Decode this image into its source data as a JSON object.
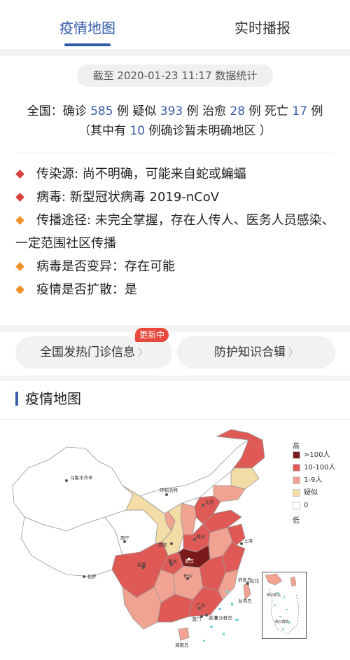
{
  "tabs": [
    {
      "label": "疫情地图",
      "active": true
    },
    {
      "label": "实时播报",
      "active": false
    }
  ],
  "date_line": "截至 2020-01-23 11:17 数据统计",
  "summary": {
    "prefix": "全国：确诊",
    "confirmed": "585",
    "unit1": "例 疑似",
    "suspected": "393",
    "unit2": "例 治愈",
    "cured": "28",
    "unit3": "例 死亡",
    "dead": "17",
    "unit4": "例",
    "line2_prefix": "（其中有",
    "unlocated": "10",
    "line2_suffix": "例确诊暂未明确地区 ）"
  },
  "facts": [
    {
      "text": "传染源: 尚不明确，可能来自蛇或蝙蝠",
      "color": "#d9423c"
    },
    {
      "text": "病毒: 新型冠状病毒 2019-nCoV",
      "color": "#d9423c"
    },
    {
      "text": "传播途径: 未完全掌握，存在人传人、医务人员感染、一定范围社区传播",
      "color": "#f0922b"
    },
    {
      "text": "病毒是否变异：存在可能",
      "color": "#f0922b"
    },
    {
      "text": "疫情是否扩散：是",
      "color": "#f0922b"
    }
  ],
  "buttons": {
    "clinics": "全国发热门诊信息",
    "protection": "防护知识合辑",
    "badge": "更新中"
  },
  "section_title": "疫情地图",
  "legend": {
    "high": "高",
    "low": "低",
    "items": [
      {
        "label": ">100人",
        "color": "#7a1a1a"
      },
      {
        "label": "10-100人",
        "color": "#e05a55"
      },
      {
        "label": "1-9人",
        "color": "#f2a290"
      },
      {
        "label": "疑似",
        "color": "#f3dca6"
      },
      {
        "label": "0",
        "color": "#ffffff"
      }
    ]
  },
  "map_labels": {
    "urumqi": "乌鲁木齐市",
    "lhasa": "拉萨",
    "xining": "西宁",
    "hohhot": "呼和浩特",
    "xian": "西安",
    "zhengzhou": "郑州",
    "wuhan": "武汉",
    "taipei": "台北",
    "hongkong": "香港",
    "macau": "澳门",
    "hainan": "海南岛",
    "diaoyu": "钓鱼岛",
    "taiwan": "台湾岛",
    "dongsha": "东沙群岛",
    "beijing": "北京",
    "shanghai": "上海",
    "changsha": "长沙",
    "guangzhou": "广州",
    "chengdu": "成都",
    "chongqing": "重庆"
  },
  "minimap_labels": [
    "西沙群岛",
    "南沙群岛"
  ]
}
